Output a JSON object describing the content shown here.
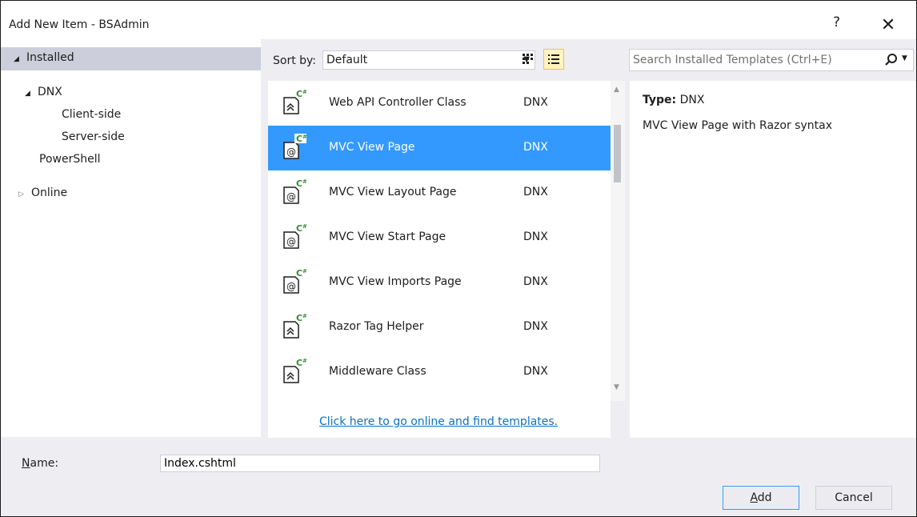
{
  "window": {
    "title": "Add New Item - BSAdmin",
    "help": "?",
    "close": "✕"
  },
  "tree": {
    "installed": "Installed",
    "dnx": "DNX",
    "client_side": "Client-side",
    "server_side": "Server-side",
    "powershell": "PowerShell",
    "online": "Online"
  },
  "sort": {
    "label": "Sort by:",
    "value": "Default"
  },
  "items": [
    {
      "name": "Web API Controller Class",
      "lang": "DNX",
      "icon": "class-cs-icon"
    },
    {
      "name": "MVC View Page",
      "lang": "DNX",
      "icon": "razor-page-icon"
    },
    {
      "name": "MVC View Layout Page",
      "lang": "DNX",
      "icon": "razor-page-icon"
    },
    {
      "name": "MVC View Start Page",
      "lang": "DNX",
      "icon": "razor-page-icon"
    },
    {
      "name": "MVC View Imports Page",
      "lang": "DNX",
      "icon": "razor-page-icon"
    },
    {
      "name": "Razor Tag Helper",
      "lang": "DNX",
      "icon": "class-cs-icon"
    },
    {
      "name": "Middleware Class",
      "lang": "DNX",
      "icon": "class-cs-icon"
    }
  ],
  "online_link": "Click here to go online and find templates.",
  "search": {
    "placeholder": "Search Installed Templates (Ctrl+E)"
  },
  "details": {
    "type_label": "Type:",
    "type_value": "DNX",
    "description": "MVC View Page with Razor syntax"
  },
  "name_field": {
    "label_first": "N",
    "label_rest": "ame:",
    "value": "Index.cshtml"
  },
  "buttons": {
    "add_first": "A",
    "add_rest": "dd",
    "cancel": "Cancel"
  },
  "colors": {
    "selection": "#3399ff",
    "link": "#0e70c0",
    "tree_header": "#cccedb",
    "dialog_bg": "#eeeef2"
  }
}
